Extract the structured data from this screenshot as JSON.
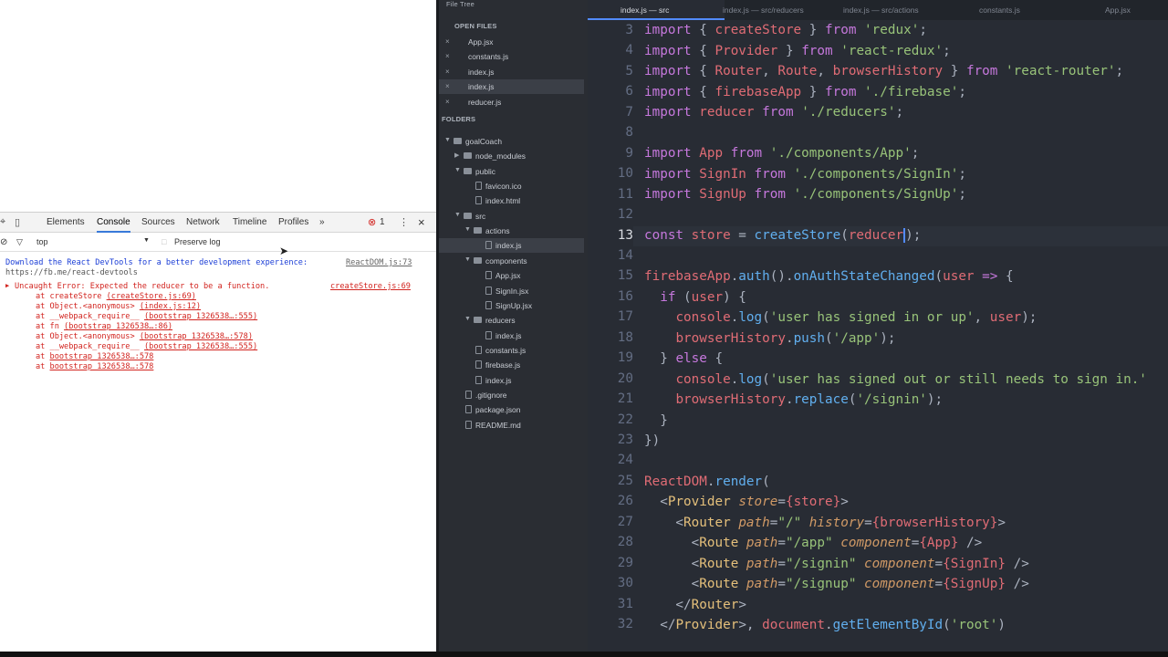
{
  "devtools": {
    "tabs": [
      "Elements",
      "Console",
      "Sources",
      "Network",
      "Timeline",
      "Profiles"
    ],
    "more_label": "»",
    "error_count": "1",
    "close_label": "×",
    "filter_context": "top",
    "preserve_log_label": "Preserve log",
    "messages": {
      "info_text": "Download the React DevTools for a better development experience:",
      "info_source": "ReactDOM.js:73",
      "info_url": "https://fb.me/react-devtools",
      "error_text": "Uncaught Error: Expected the reducer to be a function.",
      "error_source": "createStore.js:69",
      "stack": [
        {
          "prefix": "at createStore ",
          "loc": "(createStore.js:69)"
        },
        {
          "prefix": "at Object.<anonymous> ",
          "loc": "(index.js:12)"
        },
        {
          "prefix": "at __webpack_require__ ",
          "loc": "(bootstrap 1326538…:555)"
        },
        {
          "prefix": "at fn ",
          "loc": "(bootstrap 1326538…:86)"
        },
        {
          "prefix": "at Object.<anonymous> ",
          "loc": "(bootstrap 1326538…:578)"
        },
        {
          "prefix": "at __webpack_require__ ",
          "loc": "(bootstrap 1326538…:555)"
        },
        {
          "prefix": "at ",
          "loc": "bootstrap 1326538…:578"
        },
        {
          "prefix": "at ",
          "loc": "bootstrap 1326538…:578"
        }
      ]
    }
  },
  "sidebar": {
    "title": "File Tree",
    "open_files_header": "OPEN FILES",
    "open_files": [
      "App.jsx",
      "constants.js",
      "index.js",
      "index.js",
      "reducer.js"
    ],
    "folders_header": "FOLDERS",
    "tree": [
      {
        "label": "goalCoach",
        "kind": "folder",
        "depth": 0,
        "open": true
      },
      {
        "label": "node_modules",
        "kind": "folder",
        "depth": 1,
        "open": false
      },
      {
        "label": "public",
        "kind": "folder",
        "depth": 1,
        "open": true
      },
      {
        "label": "favicon.ico",
        "kind": "file",
        "depth": 2
      },
      {
        "label": "index.html",
        "kind": "file",
        "depth": 2
      },
      {
        "label": "src",
        "kind": "folder",
        "depth": 1,
        "open": true
      },
      {
        "label": "actions",
        "kind": "folder",
        "depth": 2,
        "open": true
      },
      {
        "label": "index.js",
        "kind": "file",
        "depth": 3,
        "selected": true
      },
      {
        "label": "components",
        "kind": "folder",
        "depth": 2,
        "open": true
      },
      {
        "label": "App.jsx",
        "kind": "file",
        "depth": 3
      },
      {
        "label": "SignIn.jsx",
        "kind": "file",
        "depth": 3
      },
      {
        "label": "SignUp.jsx",
        "kind": "file",
        "depth": 3
      },
      {
        "label": "reducers",
        "kind": "folder",
        "depth": 2,
        "open": true
      },
      {
        "label": "index.js",
        "kind": "file",
        "depth": 3
      },
      {
        "label": "constants.js",
        "kind": "file",
        "depth": 2
      },
      {
        "label": "firebase.js",
        "kind": "file",
        "depth": 2
      },
      {
        "label": "index.js",
        "kind": "file",
        "depth": 2
      },
      {
        "label": ".gitignore",
        "kind": "file",
        "depth": 1
      },
      {
        "label": "package.json",
        "kind": "file",
        "depth": 1
      },
      {
        "label": "README.md",
        "kind": "file",
        "depth": 1
      }
    ]
  },
  "editor": {
    "tabs": [
      "index.js — src",
      "index.js — src/reducers",
      "index.js — src/actions",
      "constants.js",
      "App.jsx"
    ],
    "current_line": "13",
    "line_numbers": [
      "3",
      "4",
      "5",
      "6",
      "7",
      "8",
      "9",
      "10",
      "11",
      "12",
      "13",
      "14",
      "15",
      "16",
      "17",
      "18",
      "19",
      "20",
      "21",
      "22",
      "23",
      "24",
      "25",
      "26",
      "27",
      "28",
      "29",
      "30",
      "31",
      "32"
    ]
  }
}
